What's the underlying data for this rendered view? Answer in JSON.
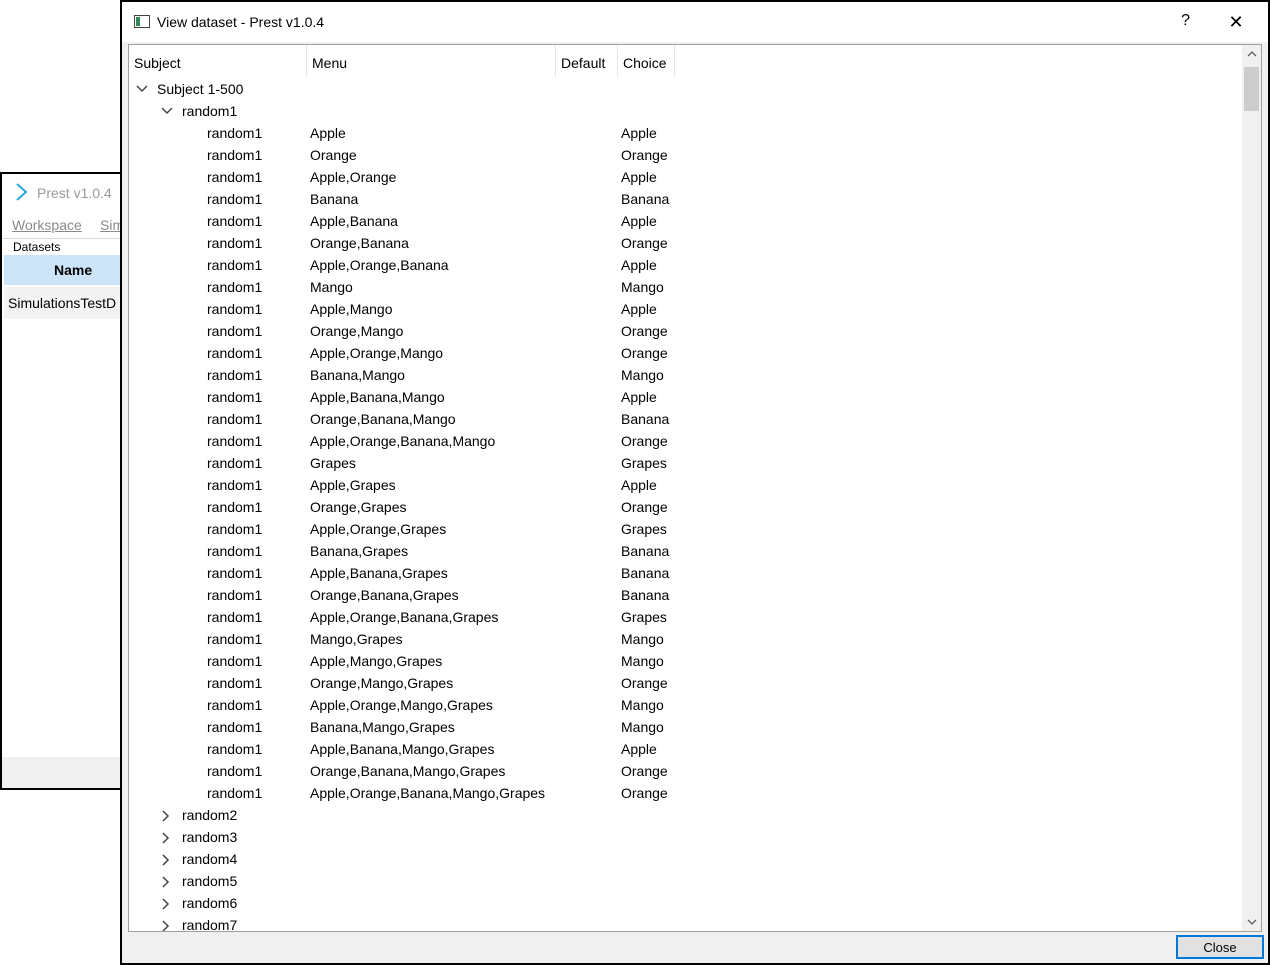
{
  "background_window": {
    "title": "Prest v1.0.4",
    "menu": [
      "Workspace",
      "Sim"
    ],
    "datasets_label": "Datasets",
    "name_header": "Name",
    "dataset_row": "SimulationsTestD"
  },
  "dialog": {
    "title": "View dataset - Prest v1.0.4",
    "help": "?",
    "close_glyph": "✕",
    "close_button": "Close"
  },
  "tree": {
    "columns": [
      "Subject",
      "Menu",
      "Default",
      "Choice"
    ],
    "root": "Subject 1-500",
    "expanded_node": "random1",
    "rows": [
      {
        "subject": "random1",
        "menu": "Apple",
        "default": "",
        "choice": "Apple"
      },
      {
        "subject": "random1",
        "menu": "Orange",
        "default": "",
        "choice": "Orange"
      },
      {
        "subject": "random1",
        "menu": "Apple,Orange",
        "default": "",
        "choice": "Apple"
      },
      {
        "subject": "random1",
        "menu": "Banana",
        "default": "",
        "choice": "Banana"
      },
      {
        "subject": "random1",
        "menu": "Apple,Banana",
        "default": "",
        "choice": "Apple"
      },
      {
        "subject": "random1",
        "menu": "Orange,Banana",
        "default": "",
        "choice": "Orange"
      },
      {
        "subject": "random1",
        "menu": "Apple,Orange,Banana",
        "default": "",
        "choice": "Apple"
      },
      {
        "subject": "random1",
        "menu": "Mango",
        "default": "",
        "choice": "Mango"
      },
      {
        "subject": "random1",
        "menu": "Apple,Mango",
        "default": "",
        "choice": "Apple"
      },
      {
        "subject": "random1",
        "menu": "Orange,Mango",
        "default": "",
        "choice": "Orange"
      },
      {
        "subject": "random1",
        "menu": "Apple,Orange,Mango",
        "default": "",
        "choice": "Orange"
      },
      {
        "subject": "random1",
        "menu": "Banana,Mango",
        "default": "",
        "choice": "Mango"
      },
      {
        "subject": "random1",
        "menu": "Apple,Banana,Mango",
        "default": "",
        "choice": "Apple"
      },
      {
        "subject": "random1",
        "menu": "Orange,Banana,Mango",
        "default": "",
        "choice": "Banana"
      },
      {
        "subject": "random1",
        "menu": "Apple,Orange,Banana,Mango",
        "default": "",
        "choice": "Orange"
      },
      {
        "subject": "random1",
        "menu": "Grapes",
        "default": "",
        "choice": "Grapes"
      },
      {
        "subject": "random1",
        "menu": "Apple,Grapes",
        "default": "",
        "choice": "Apple"
      },
      {
        "subject": "random1",
        "menu": "Orange,Grapes",
        "default": "",
        "choice": "Orange"
      },
      {
        "subject": "random1",
        "menu": "Apple,Orange,Grapes",
        "default": "",
        "choice": "Grapes"
      },
      {
        "subject": "random1",
        "menu": "Banana,Grapes",
        "default": "",
        "choice": "Banana"
      },
      {
        "subject": "random1",
        "menu": "Apple,Banana,Grapes",
        "default": "",
        "choice": "Banana"
      },
      {
        "subject": "random1",
        "menu": "Orange,Banana,Grapes",
        "default": "",
        "choice": "Banana"
      },
      {
        "subject": "random1",
        "menu": "Apple,Orange,Banana,Grapes",
        "default": "",
        "choice": "Grapes"
      },
      {
        "subject": "random1",
        "menu": "Mango,Grapes",
        "default": "",
        "choice": "Mango"
      },
      {
        "subject": "random1",
        "menu": "Apple,Mango,Grapes",
        "default": "",
        "choice": "Mango"
      },
      {
        "subject": "random1",
        "menu": "Orange,Mango,Grapes",
        "default": "",
        "choice": "Orange"
      },
      {
        "subject": "random1",
        "menu": "Apple,Orange,Mango,Grapes",
        "default": "",
        "choice": "Mango"
      },
      {
        "subject": "random1",
        "menu": "Banana,Mango,Grapes",
        "default": "",
        "choice": "Mango"
      },
      {
        "subject": "random1",
        "menu": "Apple,Banana,Mango,Grapes",
        "default": "",
        "choice": "Apple"
      },
      {
        "subject": "random1",
        "menu": "Orange,Banana,Mango,Grapes",
        "default": "",
        "choice": "Orange"
      },
      {
        "subject": "random1",
        "menu": "Apple,Orange,Banana,Mango,Grapes",
        "default": "",
        "choice": "Orange"
      }
    ],
    "collapsed_nodes": [
      "random2",
      "random3",
      "random4",
      "random5",
      "random6",
      "random7"
    ]
  },
  "colors": {
    "header_highlight": "#cce4f7",
    "accent": "#0078d7",
    "logo": "#29a8e0"
  },
  "icons": {
    "expanded": "chevron-down-icon",
    "collapsed": "chevron-right-icon",
    "scroll_up": "arrow-up-icon",
    "scroll_down": "arrow-down-icon"
  }
}
